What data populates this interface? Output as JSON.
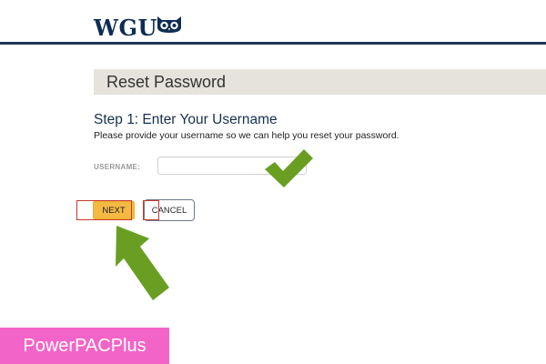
{
  "header": {
    "logo_text": "WGU",
    "logo_icon": "owl-icon",
    "brand_color": "#0f2d52"
  },
  "panel": {
    "title": "Reset Password"
  },
  "step": {
    "title": "Step 1: Enter Your Username",
    "description": "Please provide your username so we can help you reset your password."
  },
  "form": {
    "username_label": "USERNAME:",
    "username_value": "",
    "username_placeholder": ""
  },
  "buttons": {
    "next_label": "NEXT",
    "cancel_label": "CANCEL"
  },
  "annotations": {
    "check_icon": "checkmark-icon",
    "arrow_icon": "arrow-up-left-icon",
    "highlight_color": "#c53a2c",
    "accent_green": "#6a9e22"
  },
  "watermark": {
    "label": "PowerPACPlus",
    "color": "#f364c8"
  }
}
